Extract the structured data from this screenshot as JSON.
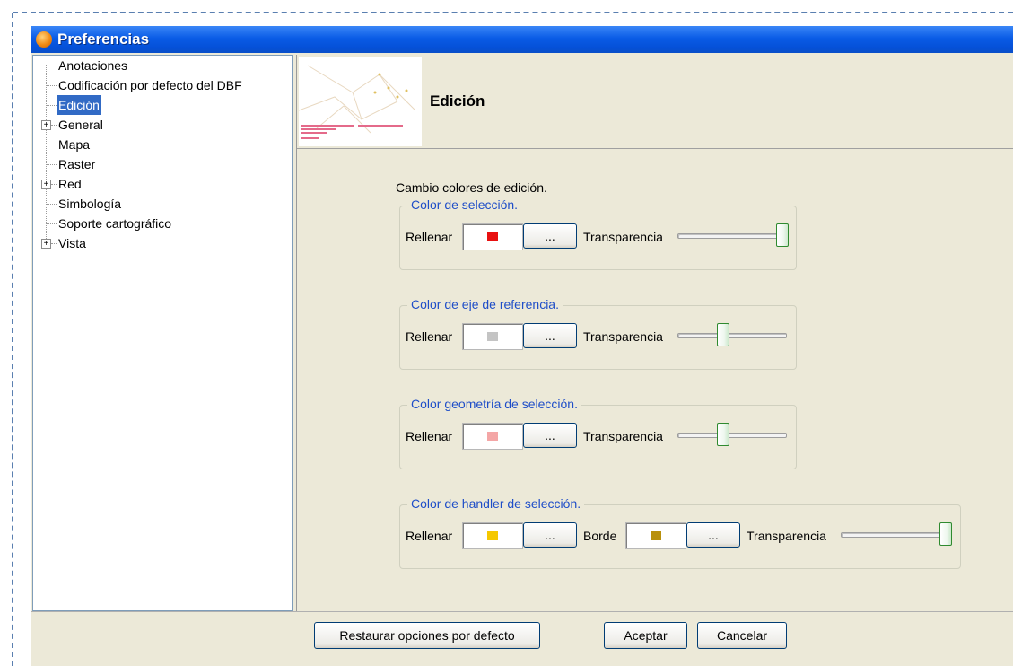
{
  "window": {
    "title": "Preferencias"
  },
  "tree": {
    "items": [
      {
        "label": "Anotaciones",
        "expandable": false,
        "selected": false
      },
      {
        "label": "Codificación por defecto del DBF",
        "expandable": false,
        "selected": false
      },
      {
        "label": "Edición",
        "expandable": false,
        "selected": true
      },
      {
        "label": "General",
        "expandable": true,
        "selected": false
      },
      {
        "label": "Mapa",
        "expandable": false,
        "selected": false
      },
      {
        "label": "Raster",
        "expandable": false,
        "selected": false
      },
      {
        "label": "Red",
        "expandable": true,
        "selected": false
      },
      {
        "label": "Simbología",
        "expandable": false,
        "selected": false
      },
      {
        "label": "Soporte cartográfico",
        "expandable": false,
        "selected": false
      },
      {
        "label": "Vista",
        "expandable": true,
        "selected": false
      }
    ],
    "expand_glyph": "+"
  },
  "panel": {
    "title": "Edición",
    "section_title": "Cambio colores de edición.",
    "groups": [
      {
        "legend": "Color de selección.",
        "fill_label": "Rellenar",
        "fill_color": "#e81010",
        "more_label": "...",
        "transparency_label": "Transparencia",
        "transparency_level": 1.0
      },
      {
        "legend": "Color de eje de referencia.",
        "fill_label": "Rellenar",
        "fill_color": "#c4c4c4",
        "more_label": "...",
        "transparency_label": "Transparencia",
        "transparency_level": 0.4
      },
      {
        "legend": "Color geometría de selección.",
        "fill_label": "Rellenar",
        "fill_color": "#f4a6a6",
        "more_label": "...",
        "transparency_label": "Transparencia",
        "transparency_level": 0.4
      },
      {
        "legend": "Color de handler de selección.",
        "fill_label": "Rellenar",
        "fill_color": "#f5c800",
        "more_label": "...",
        "border_label": "Borde",
        "border_color": "#b8900c",
        "border_more_label": "...",
        "transparency_label": "Transparencia",
        "transparency_level": 1.0
      }
    ]
  },
  "footer": {
    "restore_label": "Restaurar opciones por defecto",
    "accept_label": "Aceptar",
    "cancel_label": "Cancelar"
  },
  "colors": {
    "accent": "#0a5ce6",
    "selection": "#316ac5",
    "legend_text": "#1f4ec8"
  }
}
